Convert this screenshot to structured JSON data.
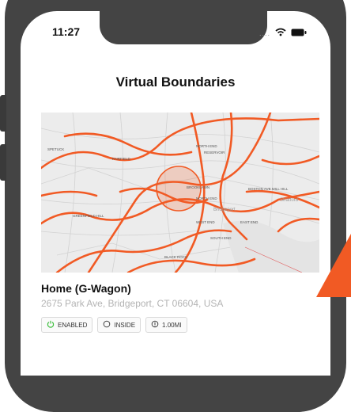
{
  "status": {
    "time": "11:27",
    "dots": "...."
  },
  "header": {
    "title": "Virtual Boundaries"
  },
  "map": {
    "labels": [
      "SPETUCK",
      "NORTH END",
      "RESERVOIR",
      "BROOKLAWN",
      "GREENFIELD HILL",
      "WEST END",
      "EAST END",
      "SOUTH END",
      "BLACK ROCK",
      "Bridgeport",
      "Stratford",
      "BOSTON AVE MILL HILL",
      "NORTH END",
      "FAIRFIELD"
    ],
    "geofence_color": "#f15a24"
  },
  "location": {
    "name": "Home (G-Wagon)",
    "address": "2675 Park Ave, Bridgeport, CT 06604, USA"
  },
  "chips": [
    {
      "label": "ENABLED",
      "icon": "power-icon"
    },
    {
      "label": "INSIDE",
      "icon": "circle-icon"
    },
    {
      "label": "1.00MI",
      "icon": "radius-icon"
    }
  ],
  "colors": {
    "accent": "#f15a24",
    "enabled": "#3fbf3f"
  }
}
